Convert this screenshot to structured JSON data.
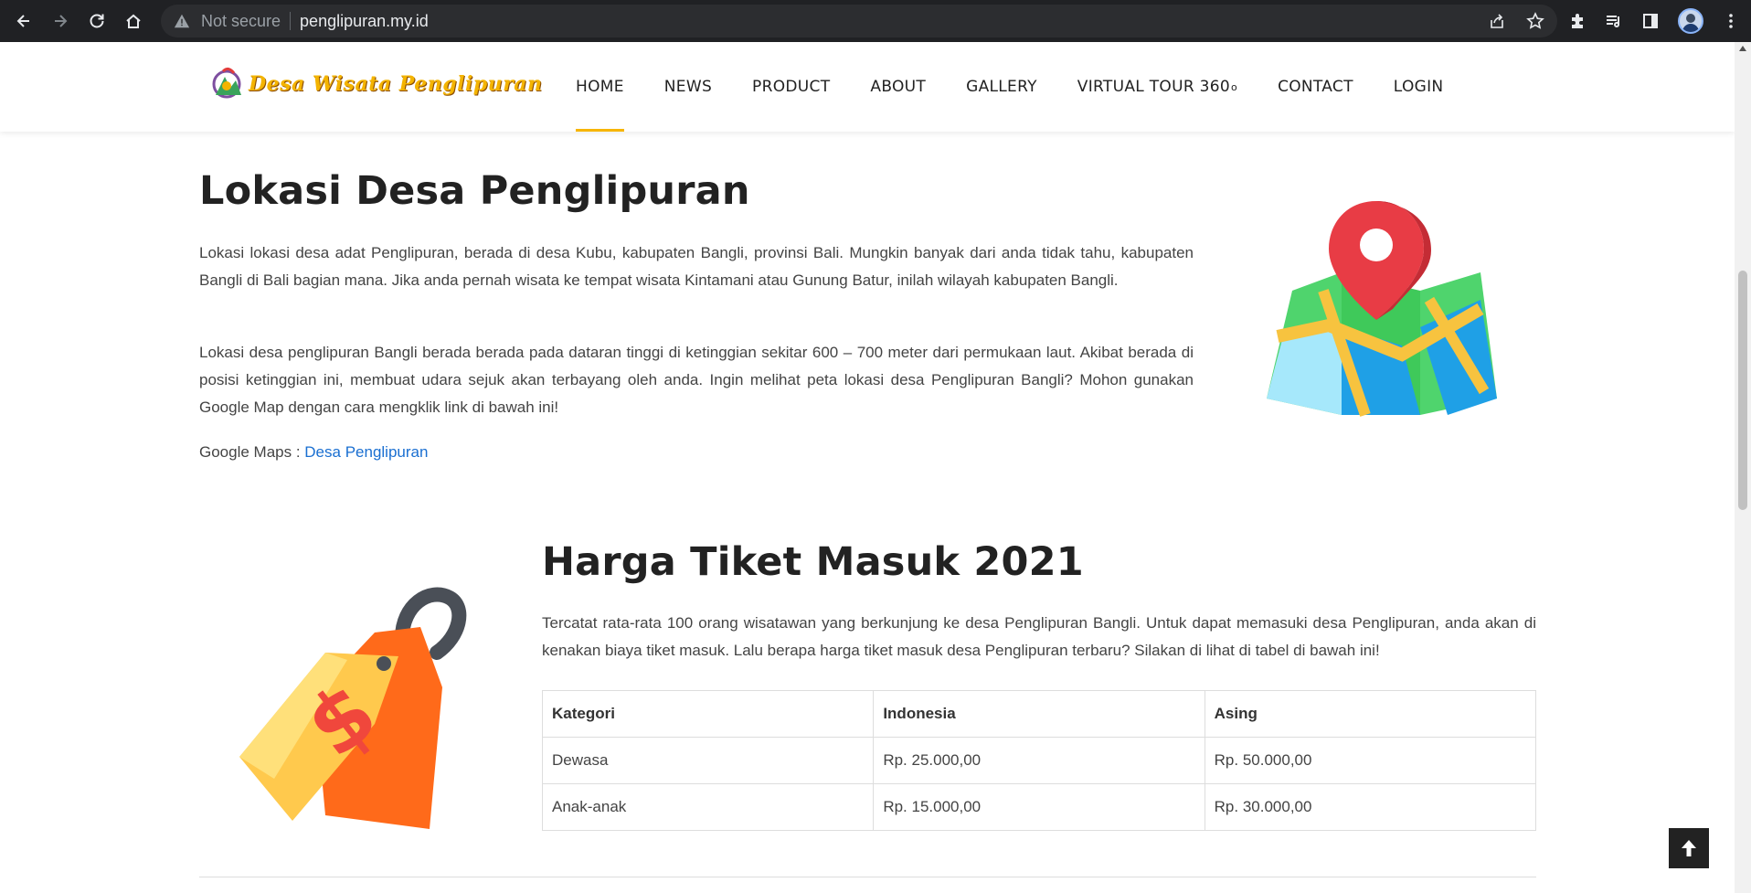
{
  "browser": {
    "security_label": "Not secure",
    "url": "penglipuran.my.id"
  },
  "header": {
    "logo_text": "Desa Wisata Penglipuran",
    "nav": [
      {
        "label": "HOME",
        "active": true
      },
      {
        "label": "NEWS"
      },
      {
        "label": "PRODUCT"
      },
      {
        "label": "ABOUT"
      },
      {
        "label": "GALLERY"
      },
      {
        "label": "VIRTUAL TOUR 360",
        "sup": "o"
      },
      {
        "label": "CONTACT"
      },
      {
        "label": "LOGIN"
      }
    ]
  },
  "location": {
    "title": "Lokasi Desa Penglipuran",
    "paragraph1": "Lokasi lokasi desa adat Penglipuran, berada di desa Kubu, kabupaten Bangli, provinsi Bali. Mungkin banyak dari anda tidak tahu, kabupaten Bangli di Bali bagian mana. Jika anda pernah wisata ke tempat wisata Kintamani atau Gunung Batur, inilah wilayah kabupaten Bangli.",
    "paragraph2": "Lokasi desa penglipuran Bangli berada berada pada dataran tinggi di ketinggian sekitar 600 – 700 meter dari permukaan laut. Akibat berada di posisi ketinggian ini, membuat udara sejuk akan terbayang oleh anda. Ingin melihat peta lokasi desa Penglipuran Bangli? Mohon gunakan Google Map dengan cara mengklik link di bawah ini!",
    "maps_label": "Google Maps : ",
    "maps_link": "Desa Penglipuran",
    "map_icon": "map-pin-icon"
  },
  "tickets": {
    "title": "Harga Tiket Masuk 2021",
    "paragraph": "Tercatat rata-rata 100 orang wisatawan yang berkunjung ke desa Penglipuran Bangli. Untuk dapat memasuki desa Penglipuran, anda akan di kenakan biaya tiket masuk. Lalu berapa harga tiket masuk desa Penglipuran terbaru? Silakan di lihat di tabel di bawah ini!",
    "table": {
      "headers": [
        "Kategori",
        "Indonesia",
        "Asing"
      ],
      "rows": [
        [
          "Dewasa",
          "Rp. 25.000,00",
          "Rp. 50.000,00"
        ],
        [
          "Anak-anak",
          "Rp. 15.000,00",
          "Rp. 30.000,00"
        ]
      ]
    },
    "tag_icon": "price-tag-icon"
  },
  "colors": {
    "accent": "#f7b500",
    "link": "#1a6fd1",
    "chrome_bg": "#202124"
  }
}
